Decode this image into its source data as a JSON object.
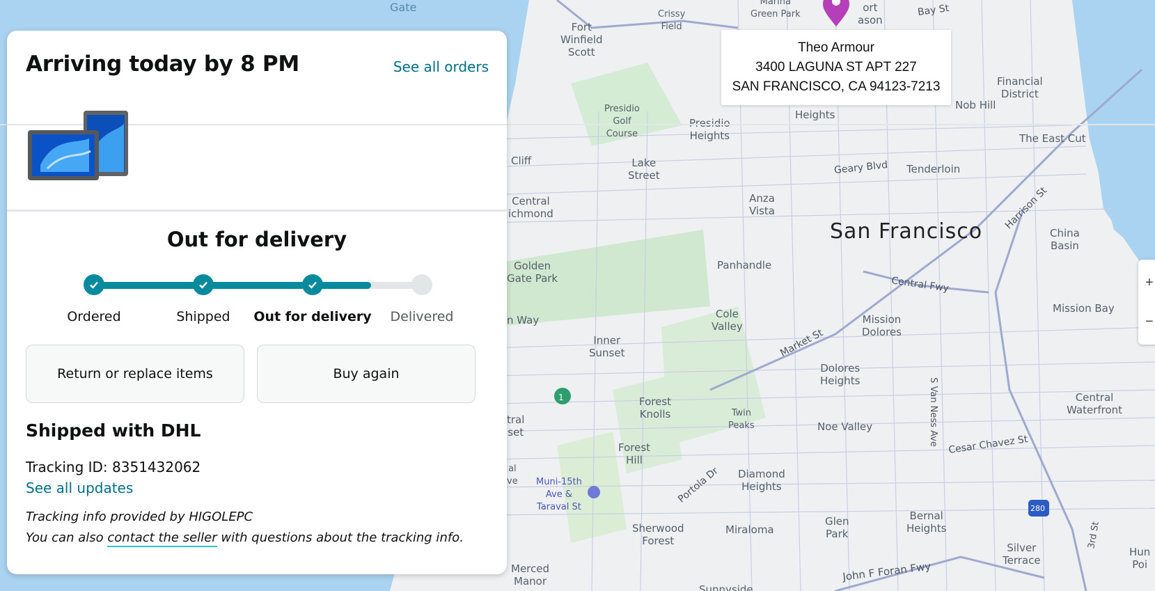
{
  "map": {
    "labels": {
      "gate": "Gate",
      "marina_green": "Marina\nGreen Park",
      "crissy_field": "Crissy\nField",
      "fort_winfield_scott": "Fort\nWinfield\nScott",
      "fort_mason": "ort\nason",
      "bay_st": "Bay St",
      "financial_district": "Financial\nDistrict",
      "presidio_golf": "Presidio\nGolf\nCourse",
      "presidio_heights": "Presidio\nHeights",
      "heights": "Heights",
      "nob_hill": "Nob Hill",
      "east_cut": "The East Cut",
      "cliff": "Cliff",
      "lake_street": "Lake\nStreet",
      "geary_blvd": "Geary Blvd",
      "tenderloin": "Tenderloin",
      "central_richmond": "Central\nichmond",
      "anza_vista": "Anza\nVista",
      "harrison_st": "Harrison St",
      "city": "San Francisco",
      "china_basin": "China\nBasin",
      "golden_gate_park": "Golden\nGate Park",
      "panhandle": "Panhandle",
      "central_fwy": "Central Fwy",
      "mission_bay": "Mission Bay",
      "n_way": "n Way",
      "cole_valley": "Cole\nValley",
      "mission_dolores": "Mission\nDolores",
      "inner_sunset": "Inner\nSunset",
      "market_st": "Market St",
      "dolores_heights": "Dolores\nHeights",
      "central_waterfront": "Central\nWaterfront",
      "s_van_ness": "S Van Ness Ave",
      "tral_set": "tral\nset",
      "forest_knolls": "Forest\nKnolls",
      "twin_peaks": "Twin\nPeaks",
      "noe_valley": "Noe Valley",
      "cesar_chavez": "Cesar Chavez St",
      "forest_hill": "Forest\nHill",
      "al_ve": "al\nve",
      "muni": "Muni-15th\nAve &\nTaraval St",
      "portola": "Portola Dr",
      "diamond_heights": "Diamond\nHeights",
      "sherwood_forest": "Sherwood\nForest",
      "miraloma": "Miraloma",
      "glen_park": "Glen\nPark",
      "bernal_heights": "Bernal\nHeights",
      "silver_terrace": "Silver\nTerrace",
      "third_st": "3rd St",
      "hun": "Hun\nPoi",
      "merced_manor": "Merced\nManor",
      "john_foran": "John F Foran Fwy",
      "sunnyside": "Sunnyside",
      "hwy1": "1",
      "hwy280": "280"
    },
    "zoom_in": "+",
    "zoom_out": "−"
  },
  "address": {
    "name": "Theo Armour",
    "line1": "3400 LAGUNA ST APT 227",
    "line2": "SAN FRANCISCO, CA 94123-7213"
  },
  "order": {
    "arrival": "Arriving today by 8 PM",
    "see_all_orders": "See all orders",
    "status_title": "Out for delivery",
    "progress_fraction": 0.83,
    "steps": [
      {
        "label": "Ordered",
        "state": "done"
      },
      {
        "label": "Shipped",
        "state": "done"
      },
      {
        "label": "Out for delivery",
        "state": "current"
      },
      {
        "label": "Delivered",
        "state": "pending"
      }
    ],
    "return_button": "Return or replace items",
    "buy_again_button": "Buy again",
    "carrier": "Shipped with DHL",
    "tracking_label": "Tracking ID: 8351432062",
    "see_all_updates": "See all updates",
    "note_line1": "Tracking info provided by HIGOLEPC",
    "note_prefix": "You can also ",
    "note_link": "contact the seller",
    "note_suffix": " with questions about the tracking info."
  },
  "colors": {
    "accent": "#078a9e",
    "link": "#007185",
    "pin": "#b43fb8",
    "water": "#a9d3f0",
    "land": "#eef0f2"
  }
}
